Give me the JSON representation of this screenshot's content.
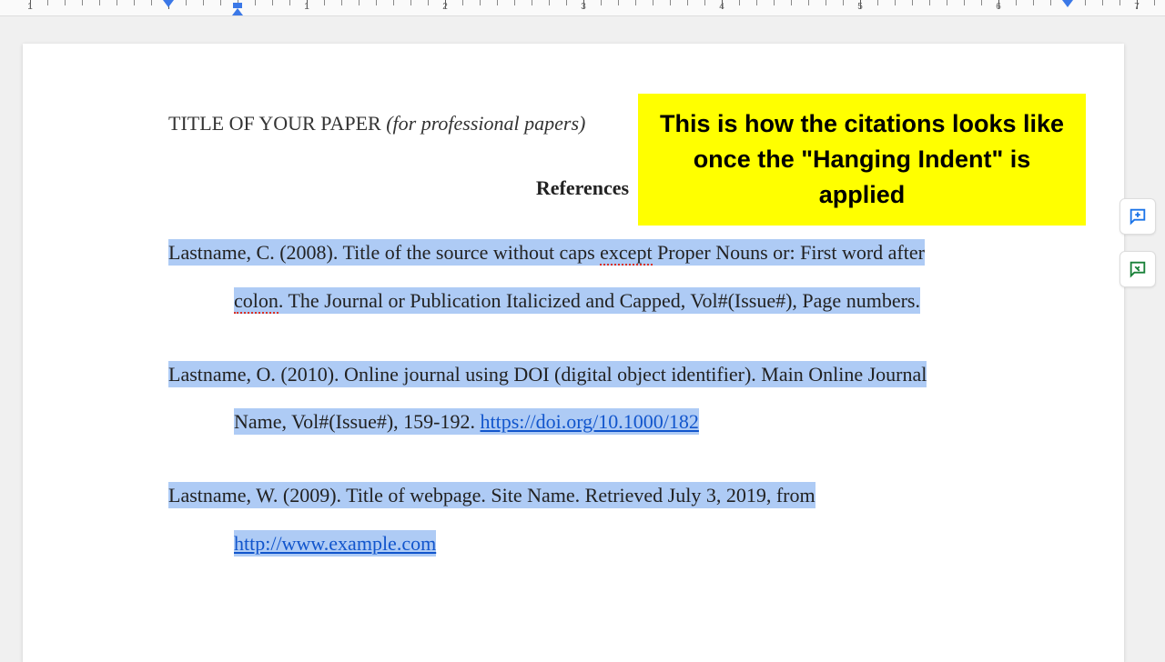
{
  "ruler": {
    "numbers": [
      1,
      2,
      3,
      4,
      5,
      6,
      7
    ],
    "left_margin_tick": 1,
    "indent_marker_pos": 0,
    "hanging_marker_pos": 0.5,
    "right_marker_pos": 6.5
  },
  "document": {
    "title_prefix": "TITLE OF YOUR PAPER ",
    "title_italic": "(for professional papers)",
    "heading": "References",
    "citations": [
      {
        "line1_a": "Lastname, C. (2008). Title of the source without caps ",
        "line1_err": "except",
        "line1_b": " Proper Nouns or: First word after",
        "line2_err": "colon",
        "line2_a": ". The Journal or Publication Italicized and Capped, Vol#(Issue#), Page numbers.",
        "link": ""
      },
      {
        "line1_a": "Lastname, O. (2010). Online journal using DOI (digital object identifier). Main Online Journal",
        "line1_err": "",
        "line1_b": "",
        "line2_err": "",
        "line2_a": "Name, Vol#(Issue#), 159-192. ",
        "link": "https://doi.org/10.1000/182"
      },
      {
        "line1_a": "Lastname, W. (2009). Title of webpage. Site Name. Retrieved July 3, 2019, from",
        "line1_err": "",
        "line1_b": "",
        "line2_err": "",
        "line2_a": "",
        "link": "http://www.example.com"
      }
    ]
  },
  "annotation": {
    "text": "This is how the citations looks like once the \"Hanging Indent\" is applied"
  },
  "side_buttons": {
    "add_comment": "add-comment",
    "suggest": "suggest-edits"
  }
}
